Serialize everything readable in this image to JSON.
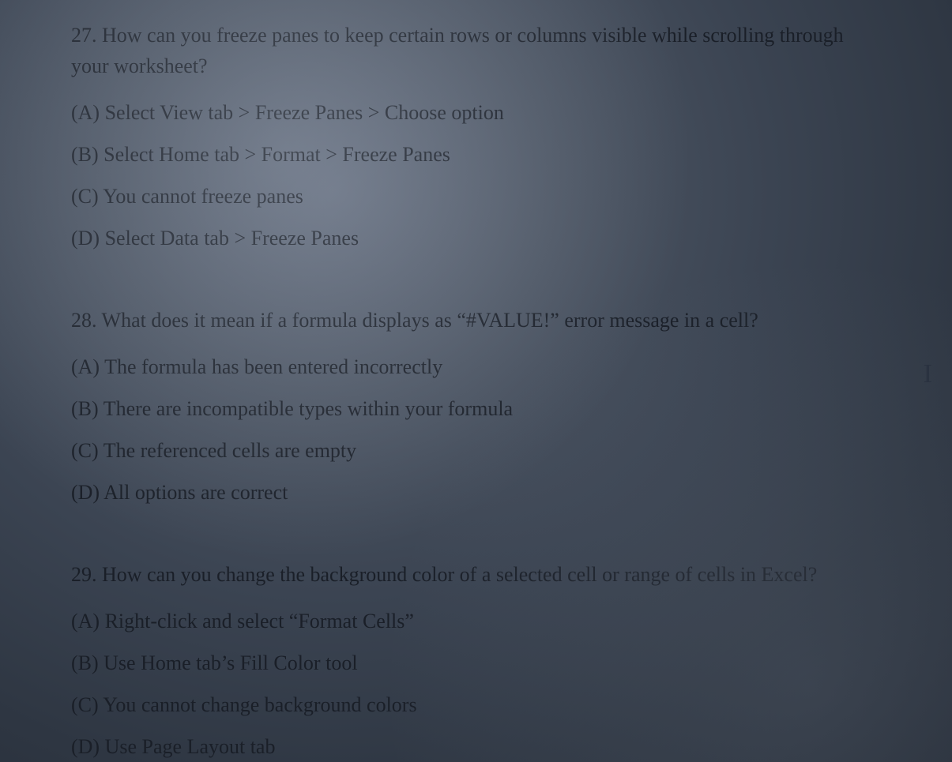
{
  "questions": [
    {
      "number": "27.",
      "text": "How can you freeze panes to keep certain rows or columns visible while scrolling through your worksheet?",
      "options": {
        "A": "(A) Select View tab > Freeze Panes > Choose option",
        "B": "(B) Select Home tab > Format > Freeze Panes",
        "C": "(C) You cannot freeze panes",
        "D": "(D) Select Data tab > Freeze Panes"
      }
    },
    {
      "number": "28.",
      "text": "What does it mean if a formula displays as “#VALUE!” error message in a cell?",
      "options": {
        "A": "(A) The formula has been entered incorrectly",
        "B": "(B) There are incompatible types within your formula",
        "C": "(C) The referenced cells are empty",
        "D": "(D) All options are correct"
      }
    },
    {
      "number": "29.",
      "text": "How can you change the background color of a selected cell or range of cells in Excel?",
      "options": {
        "A": "(A) Right-click and select “Format Cells”",
        "B": "(B) Use Home tab’s Fill Color tool",
        "C": "(C) You cannot change background colors",
        "D": "(D) Use Page Layout tab"
      }
    }
  ],
  "cursor_glyph": "I"
}
